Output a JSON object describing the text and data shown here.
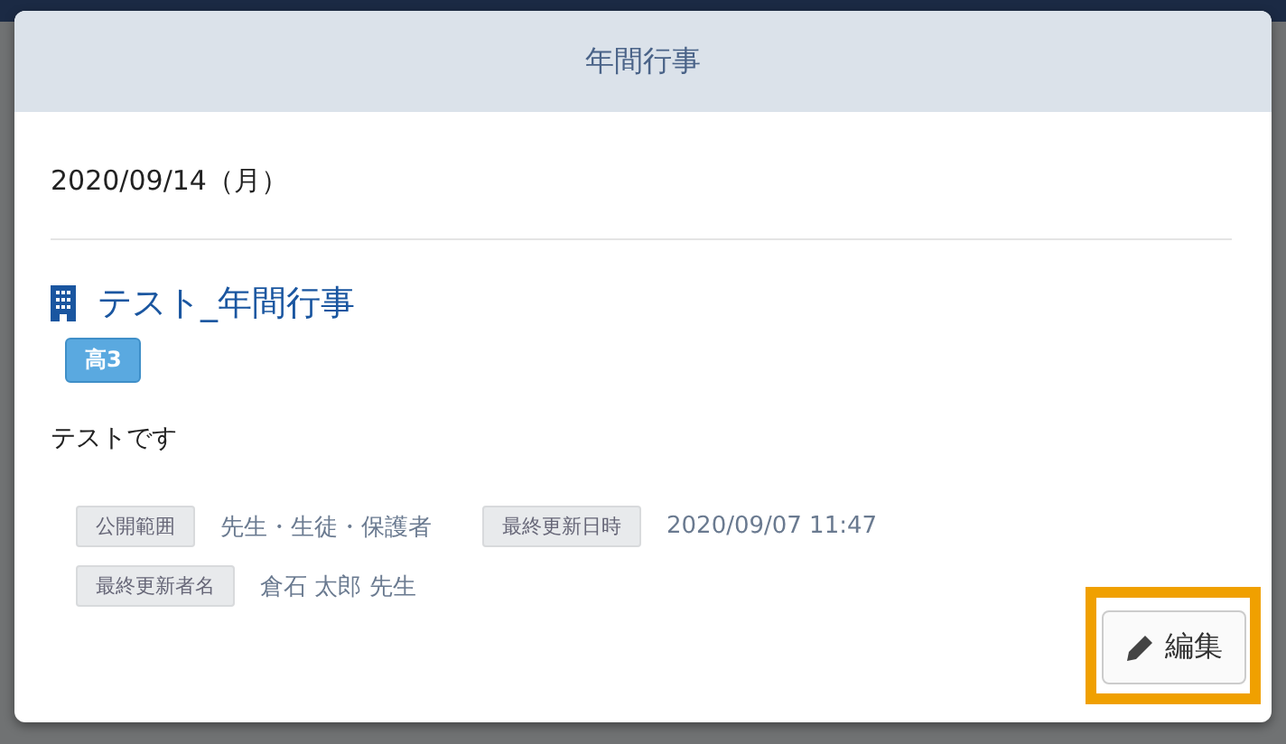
{
  "dialog": {
    "title": "年間行事"
  },
  "date": "2020/09/14（月）",
  "event": {
    "title": "テスト_年間行事",
    "badge": "高3",
    "description": "テストです"
  },
  "meta": [
    {
      "label": "公開範囲",
      "value": "先生・生徒・保護者"
    },
    {
      "label": "最終更新日時",
      "value": "2020/09/07 11:47"
    },
    {
      "label": "最終更新者名",
      "value": "倉石 太郎 先生"
    }
  ],
  "edit_button": {
    "label": "編集",
    "highlighted": true
  }
}
